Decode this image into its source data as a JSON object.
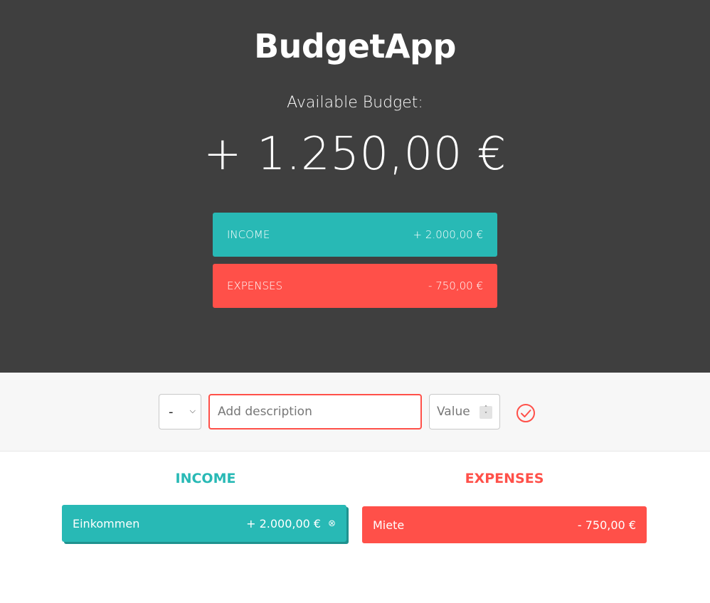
{
  "app": {
    "title": "BudgetApp"
  },
  "budget": {
    "label": "Available Budget:",
    "value": "+ 1.250,00 €"
  },
  "summary": {
    "income": {
      "label": "INCOME",
      "value": "+ 2.000,00 €"
    },
    "expenses": {
      "label": "EXPENSES",
      "value": "- 750,00 €"
    }
  },
  "add_form": {
    "type_selected": "-",
    "description_placeholder": "Add description",
    "description_value": "",
    "value_placeholder": "Value",
    "add_icon": "check-circle-icon"
  },
  "lists": {
    "income": {
      "title": "INCOME",
      "items": [
        {
          "description": "Einkommen",
          "value": "+ 2.000,00 €"
        }
      ]
    },
    "expenses": {
      "title": "EXPENSES",
      "items": [
        {
          "description": "Miete",
          "value": "- 750,00 €"
        }
      ]
    }
  },
  "colors": {
    "header_bg": "#3f3f3f",
    "income": "#28b9b5",
    "expenses": "#ff5049",
    "bar_bg": "#f7f7f7"
  }
}
